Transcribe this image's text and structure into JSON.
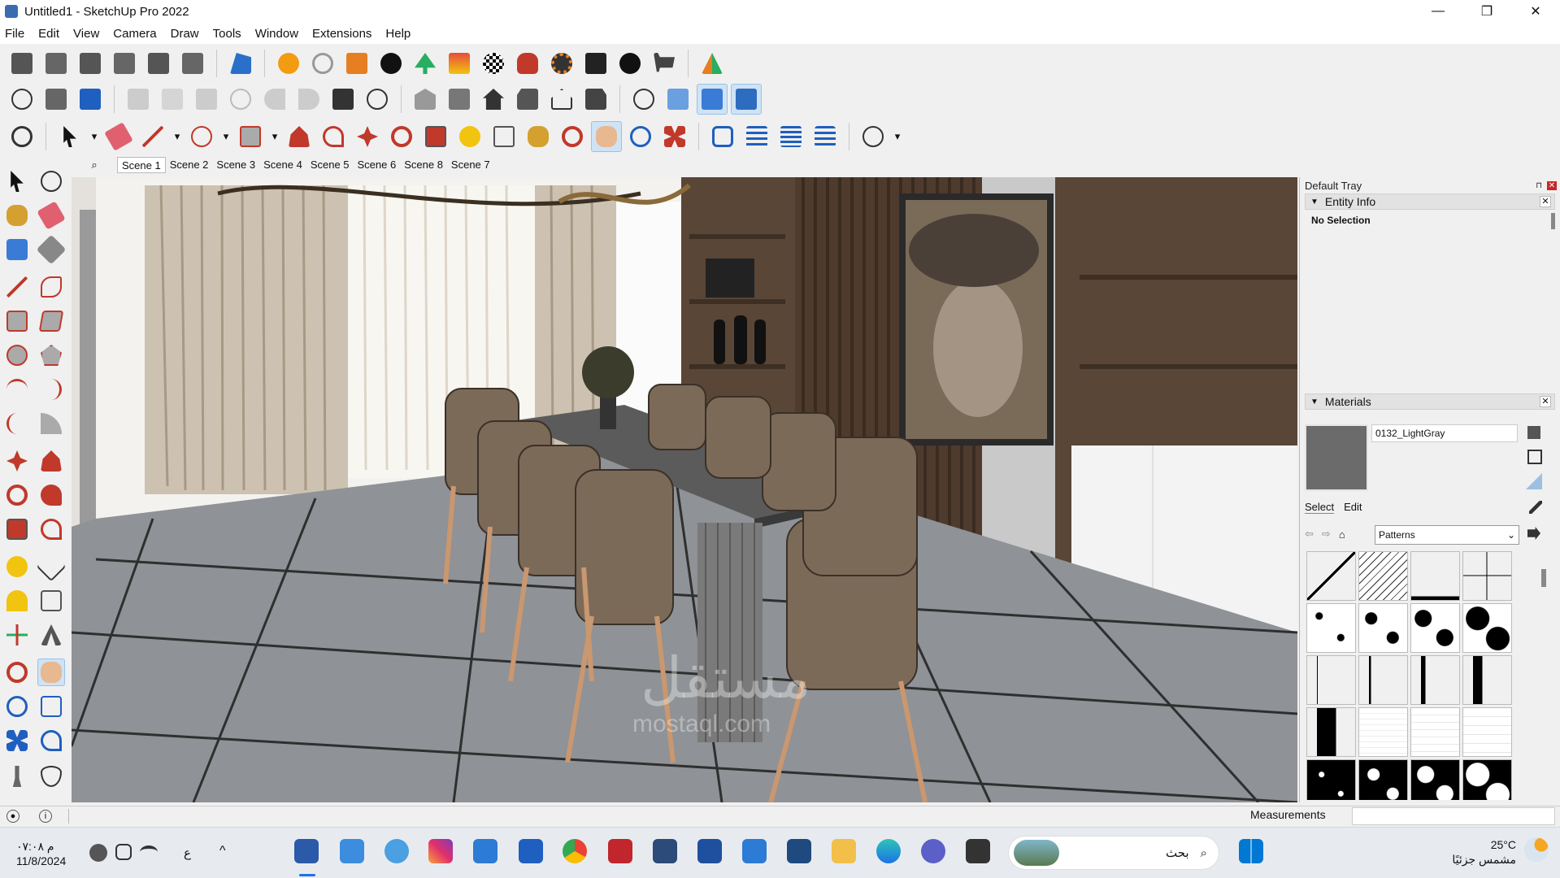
{
  "window": {
    "title": "Untitled1 - SketchUp Pro 2022",
    "minimize": "—",
    "restore": "❐",
    "close": "✕"
  },
  "menu": [
    "File",
    "Edit",
    "View",
    "Camera",
    "Draw",
    "Tools",
    "Window",
    "Extensions",
    "Help"
  ],
  "scenes": [
    "Scene 1",
    "Scene 2",
    "Scene 3",
    "Scene 4",
    "Scene 5",
    "Scene 6",
    "Scene 8",
    "Scene 7"
  ],
  "scene_search_icon": "search-icon",
  "tray": {
    "title": "Default Tray",
    "entity_info": {
      "header": "Entity Info",
      "selection": "No Selection"
    },
    "materials": {
      "header": "Materials",
      "name": "0132_LightGray",
      "swatch_color": "#6b6b6b",
      "tabs": [
        "Select",
        "Edit"
      ],
      "library": "Patterns"
    }
  },
  "status": {
    "measurements_label": "Measurements"
  },
  "taskbar": {
    "time": "م ٠٧:٠٨",
    "date": "11/8/2024",
    "search": "بحث",
    "weather_temp": "25°C",
    "weather_desc": "مشمس جزئيًا",
    "lang": "ع",
    "chevron": "^"
  },
  "viewport": {
    "watermark": "مستقل",
    "watermark_sub": "mostaql.com"
  },
  "colors": {
    "accent": "#1a73e8",
    "active_tool": "#cfe3f6"
  }
}
